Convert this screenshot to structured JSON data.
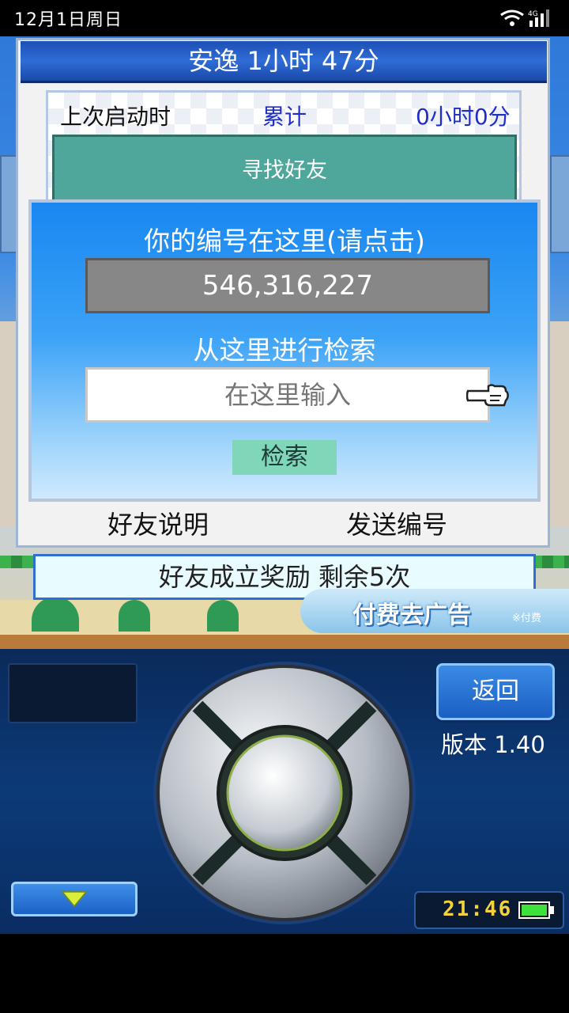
{
  "status_bar": {
    "date": "12月1日周日",
    "network": "4G"
  },
  "dialog": {
    "title": "安逸  1小时 47分",
    "last_launch_label": "上次启动时",
    "total_label": "累计",
    "total_value": "0小时0分",
    "find_friend_label": "寻找好友"
  },
  "friend_panel": {
    "id_hint": "你的编号在这里(请点击)",
    "id_value": "546,316,227",
    "search_hint": "从这里进行检索",
    "search_placeholder": "在这里输入",
    "search_button": "检索"
  },
  "dialog_footer": {
    "help_label": "好友说明",
    "send_label": "发送编号"
  },
  "reward_bar": {
    "text": "好友成立奖励  剩余5次"
  },
  "ad": {
    "text": "付费去广告",
    "note": "※付费"
  },
  "controller": {
    "back_label": "返回",
    "version": "版本 1.40",
    "clock": "21:46"
  },
  "colors": {
    "title_blue": "#2f6dd6",
    "panel_blue": "#1987f0",
    "teal": "#4ea79a",
    "link_blue": "#1d2fc8",
    "clock_yellow": "#f4d23c",
    "battery_green": "#3de03d"
  }
}
